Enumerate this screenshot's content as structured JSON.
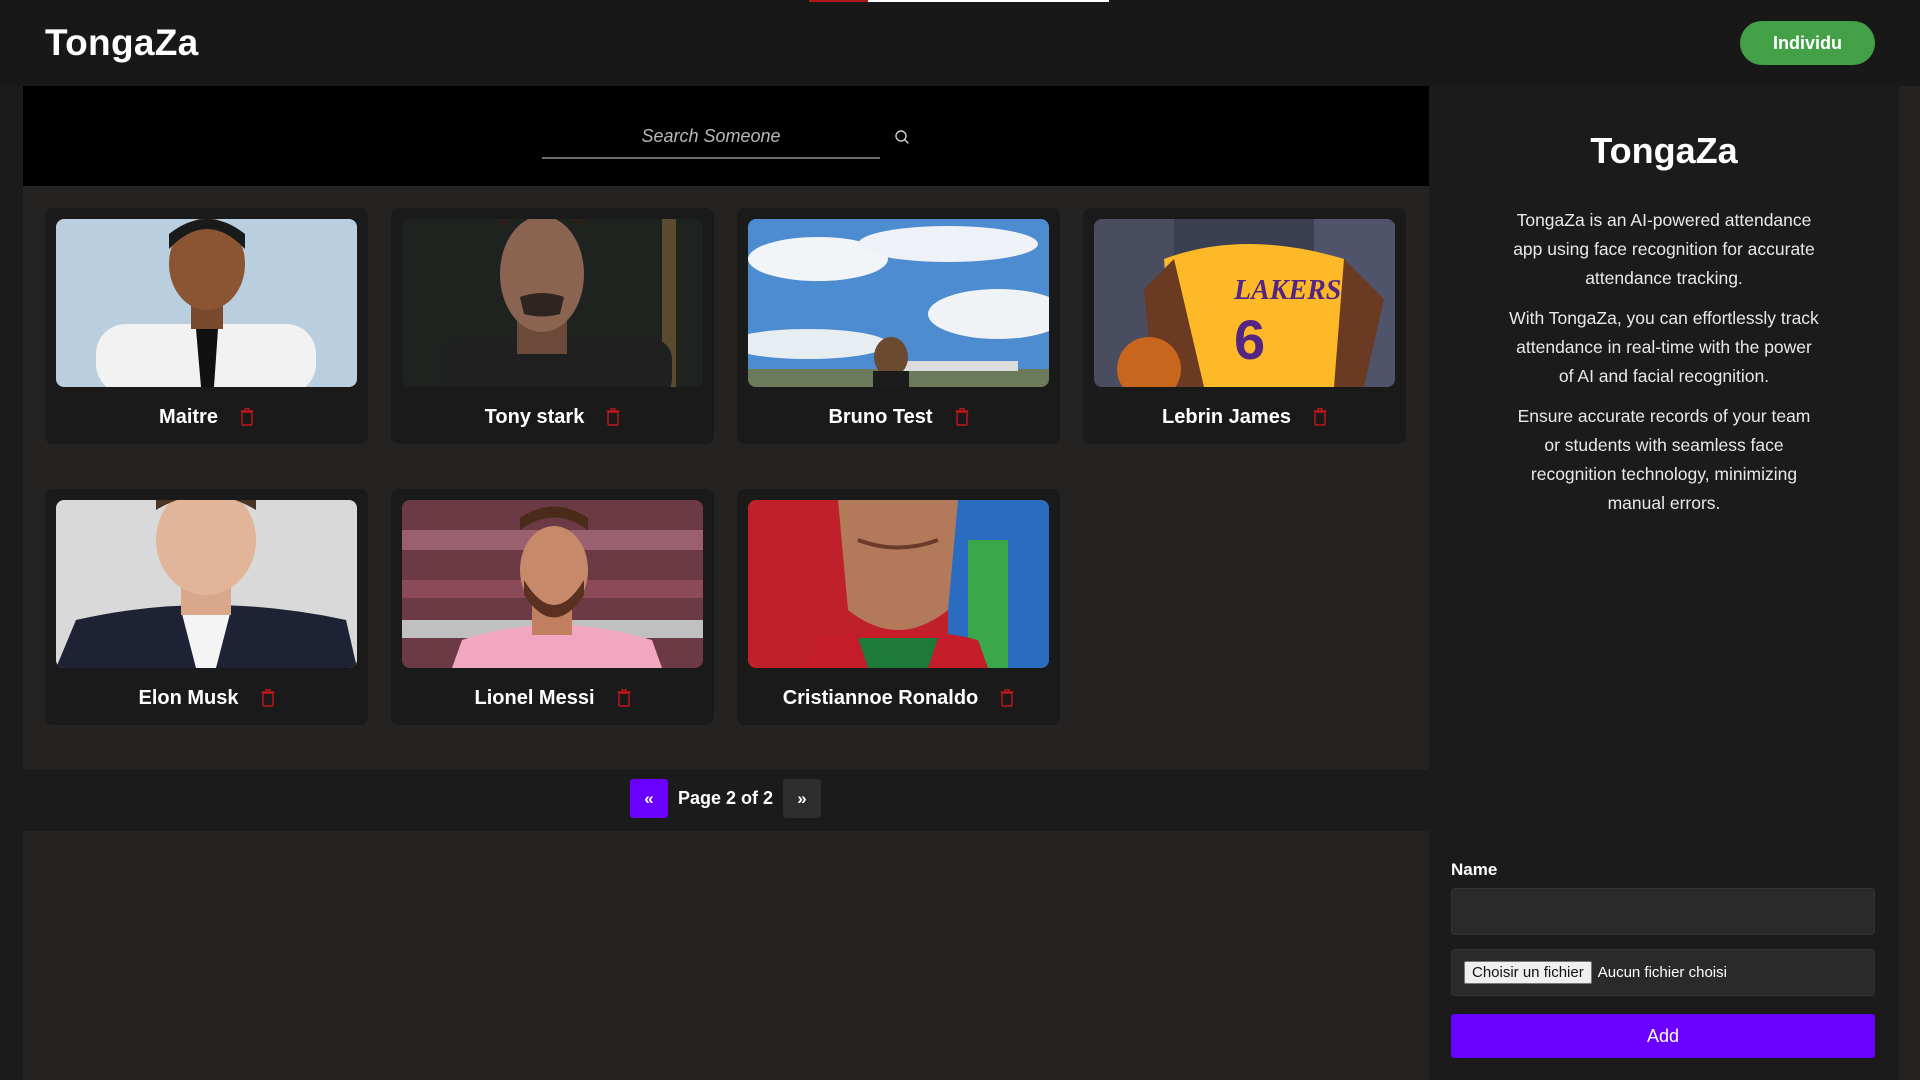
{
  "header": {
    "logo": "TongaZa",
    "individu_label": "Individu"
  },
  "search": {
    "placeholder": "Search Someone"
  },
  "people": [
    {
      "name": "Maitre"
    },
    {
      "name": "Tony stark"
    },
    {
      "name": "Bruno Test"
    },
    {
      "name": "Lebrin James"
    },
    {
      "name": "Elon Musk"
    },
    {
      "name": "Lionel Messi"
    },
    {
      "name": "Cristiannoe Ronaldo"
    }
  ],
  "pagination": {
    "prev_label": "«",
    "page_text": "Page 2 of 2",
    "next_label": "»"
  },
  "sidebar": {
    "title": "TongaZa",
    "paragraphs": [
      "TongaZa is an AI-powered attendance app using face recognition for accurate attendance tracking.",
      "With TongaZa, you can effortlessly track attendance in real-time with the power of AI and facial recognition.",
      "Ensure accurate records of your team or students with seamless face recognition technology, minimizing manual errors."
    ],
    "form": {
      "name_label": "Name",
      "name_value": "",
      "file_button": "Choisir un fichier",
      "file_status": "Aucun fichier choisi",
      "add_label": "Add"
    }
  },
  "colors": {
    "accent": "#6a00ff",
    "success": "#43a047",
    "danger": "#b01818"
  },
  "icons": {
    "search": "search-icon",
    "delete": "trash-icon"
  }
}
